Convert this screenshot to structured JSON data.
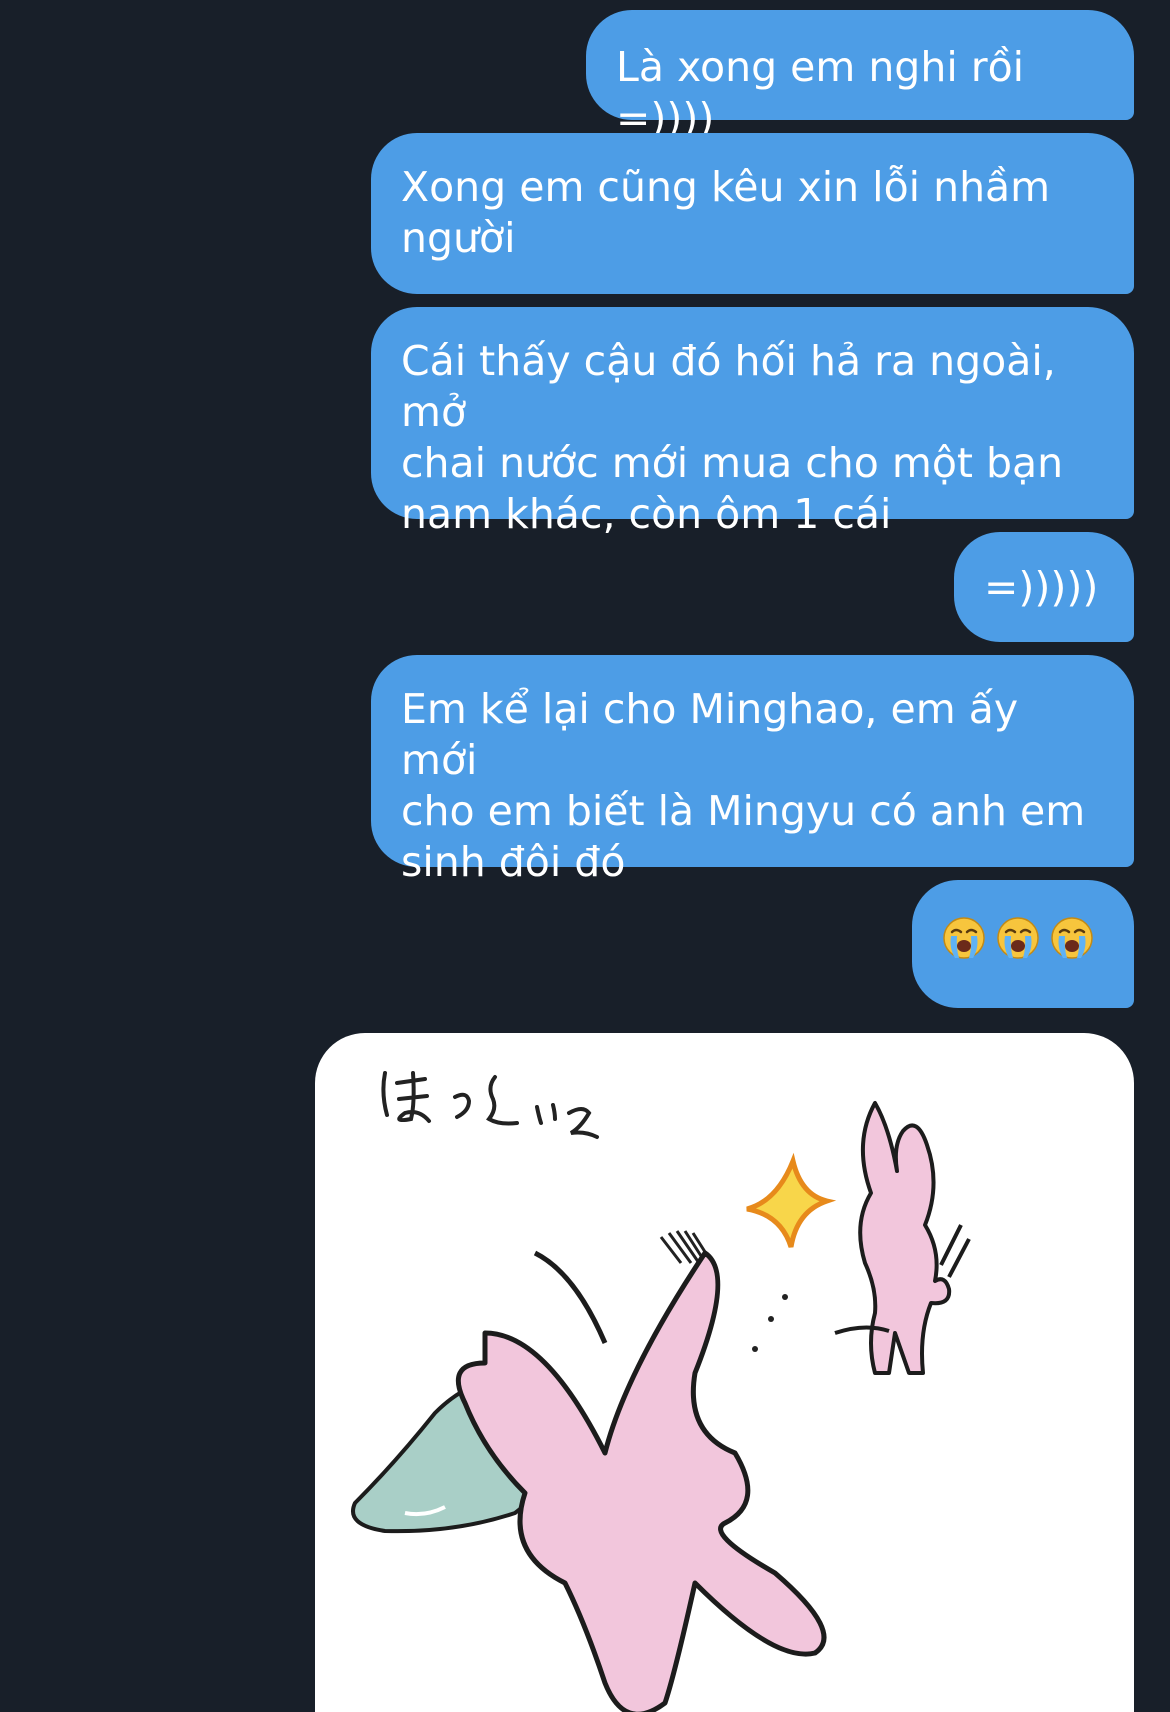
{
  "messages": [
    {
      "lines": [
        "Là xong em nghi rồi =))))"
      ]
    },
    {
      "lines": [
        "Xong em cũng kêu xin lỗi nhầm",
        "người"
      ]
    },
    {
      "lines": [
        "Cái thấy cậu đó hối hả ra ngoài, mở",
        "chai nước mới mua cho một bạn",
        "nam khác, còn ôm 1 cái"
      ]
    },
    {
      "lines": [
        "=)))))"
      ]
    },
    {
      "lines": [
        "Em kể lại cho Minghao, em ấy mới",
        "cho em biết là Mingyu có anh em",
        "sinh đôi đó"
      ]
    },
    {
      "emojis": [
        "loudly-crying-face",
        "loudly-crying-face",
        "loudly-crying-face"
      ]
    }
  ],
  "sticker": {
    "caption": "ほっといて",
    "description": "two pink rabbits, one swatting the other"
  },
  "colors": {
    "background": "#181f29",
    "bubble": "#4d9de6",
    "bubble_text": "#ffffff"
  }
}
